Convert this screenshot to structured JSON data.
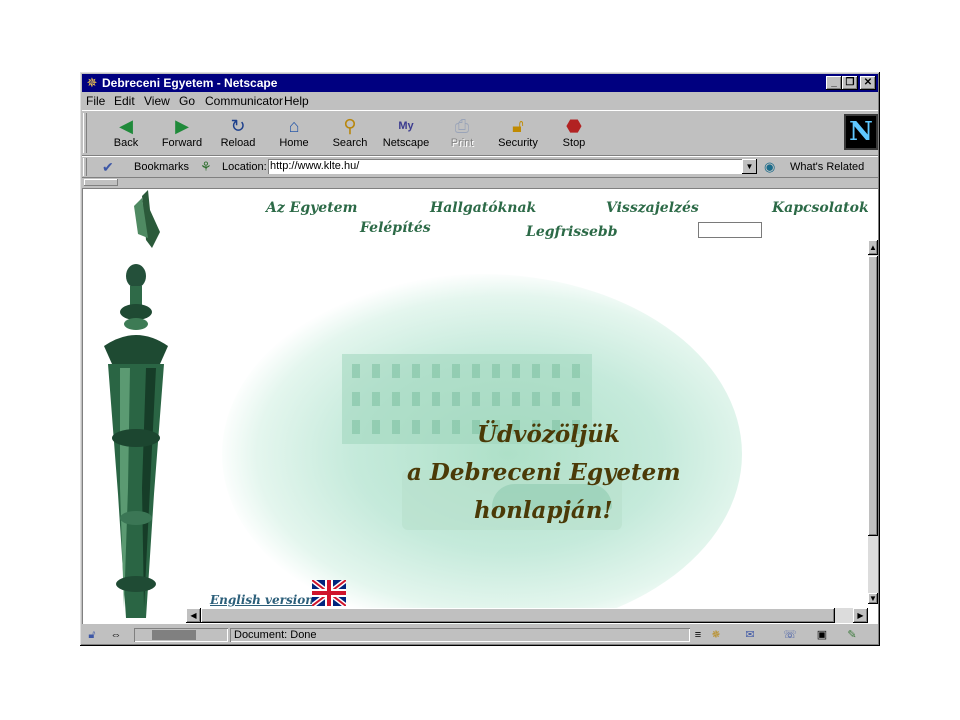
{
  "window": {
    "title": "Debreceni Egyetem - Netscape"
  },
  "menu": [
    "File",
    "Edit",
    "View",
    "Go",
    "Communicator",
    "Help"
  ],
  "toolbar": {
    "back": "Back",
    "forward": "Forward",
    "reload": "Reload",
    "home": "Home",
    "search": "Search",
    "netscape": "Netscape",
    "print": "Print",
    "security": "Security",
    "stop": "Stop"
  },
  "location": {
    "bookmarks_label": "Bookmarks",
    "location_label": "Location:",
    "url": "http://www.klte.hu/",
    "whats_related": "What's Related"
  },
  "page": {
    "nav": {
      "az_egyetem": "Az Egyetem",
      "hallgatoknak": "Hallgatóknak",
      "visszajelzes": "Visszajelzés",
      "kapcsolatok": "Kapcsolatok",
      "felepites": "Felépítés",
      "legfrissebb": "Legfrissebb"
    },
    "welcome": [
      "Üdvözöljük",
      "a Debreceni Egyetem",
      "honlapján!"
    ],
    "english_link": "English version"
  },
  "status": {
    "text": "Document: Done"
  },
  "colors": {
    "title_bar": "#000080",
    "nav_text": "#2c6a47",
    "welcome_text": "#4b3a07",
    "link": "#2c5f7a"
  }
}
